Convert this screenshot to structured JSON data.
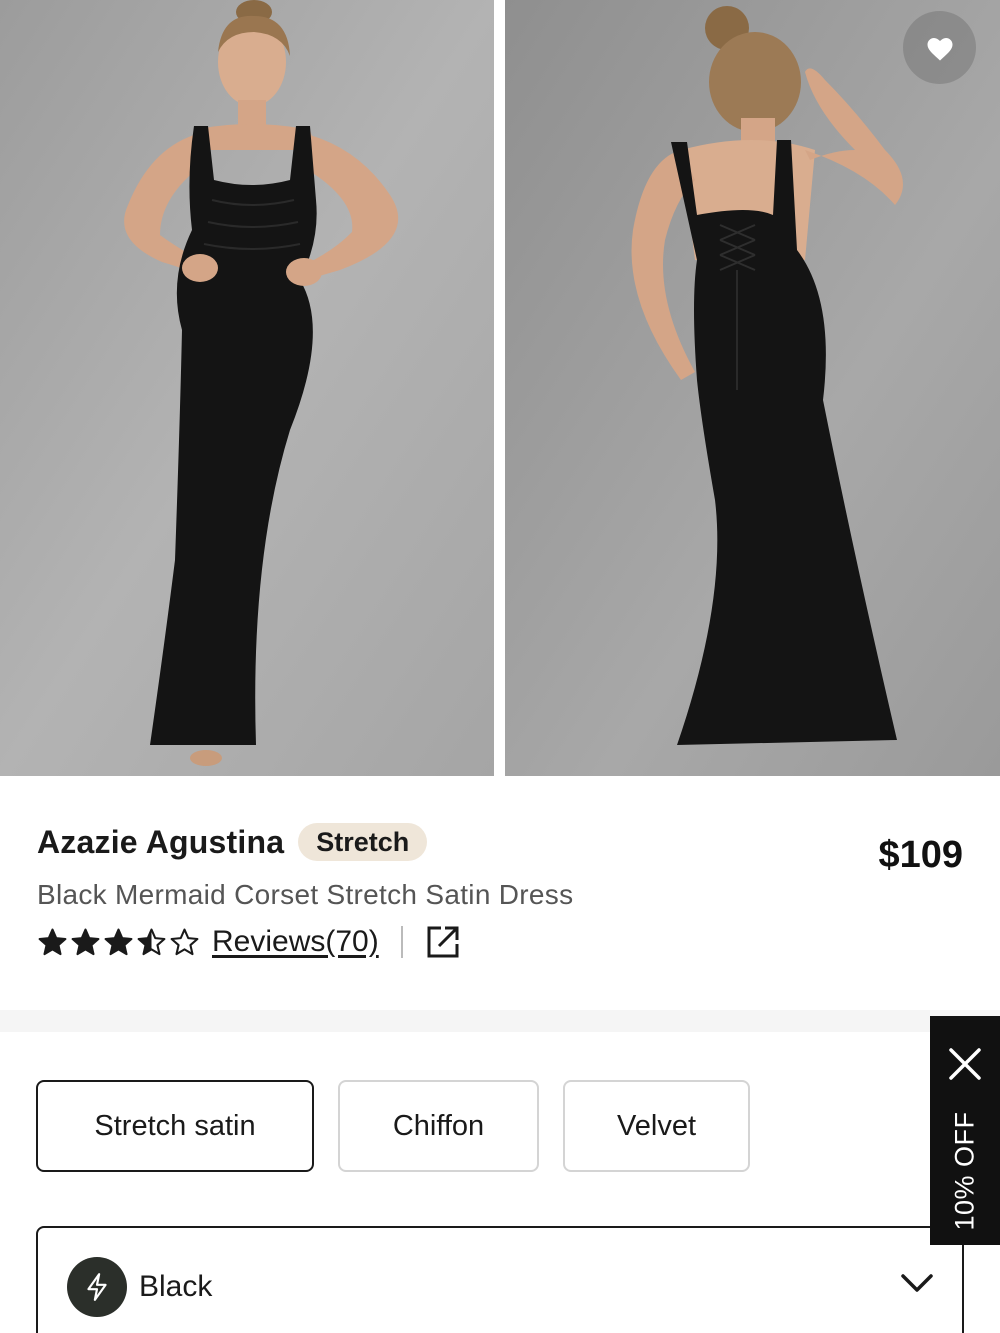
{
  "product": {
    "brand_title": "Azazie Agustina",
    "badge": "Stretch",
    "subtitle": "Black Mermaid Corset Stretch Satin Dress",
    "price": "$109",
    "rating": 3.5,
    "rating_max": 5,
    "reviews_label": "Reviews(70)"
  },
  "gallery": {
    "images": [
      {
        "name": "front-view-photo",
        "icon": "model-front-photo"
      },
      {
        "name": "back-view-photo",
        "icon": "model-back-photo"
      }
    ],
    "favorite_icon": "heart-icon"
  },
  "fabrics": [
    {
      "label": "Stretch satin",
      "selected": true
    },
    {
      "label": "Chiffon",
      "selected": false
    },
    {
      "label": "Velvet",
      "selected": false
    }
  ],
  "color_select": {
    "value": "Black",
    "icon": "lightning-icon"
  },
  "promo": {
    "label": "10% OFF",
    "close_icon": "close-icon"
  },
  "colors": {
    "badge_bg": "#efe6d9",
    "photo_bg": "#a9a9a9",
    "dress": "#141414",
    "promo_bg": "#111111"
  }
}
